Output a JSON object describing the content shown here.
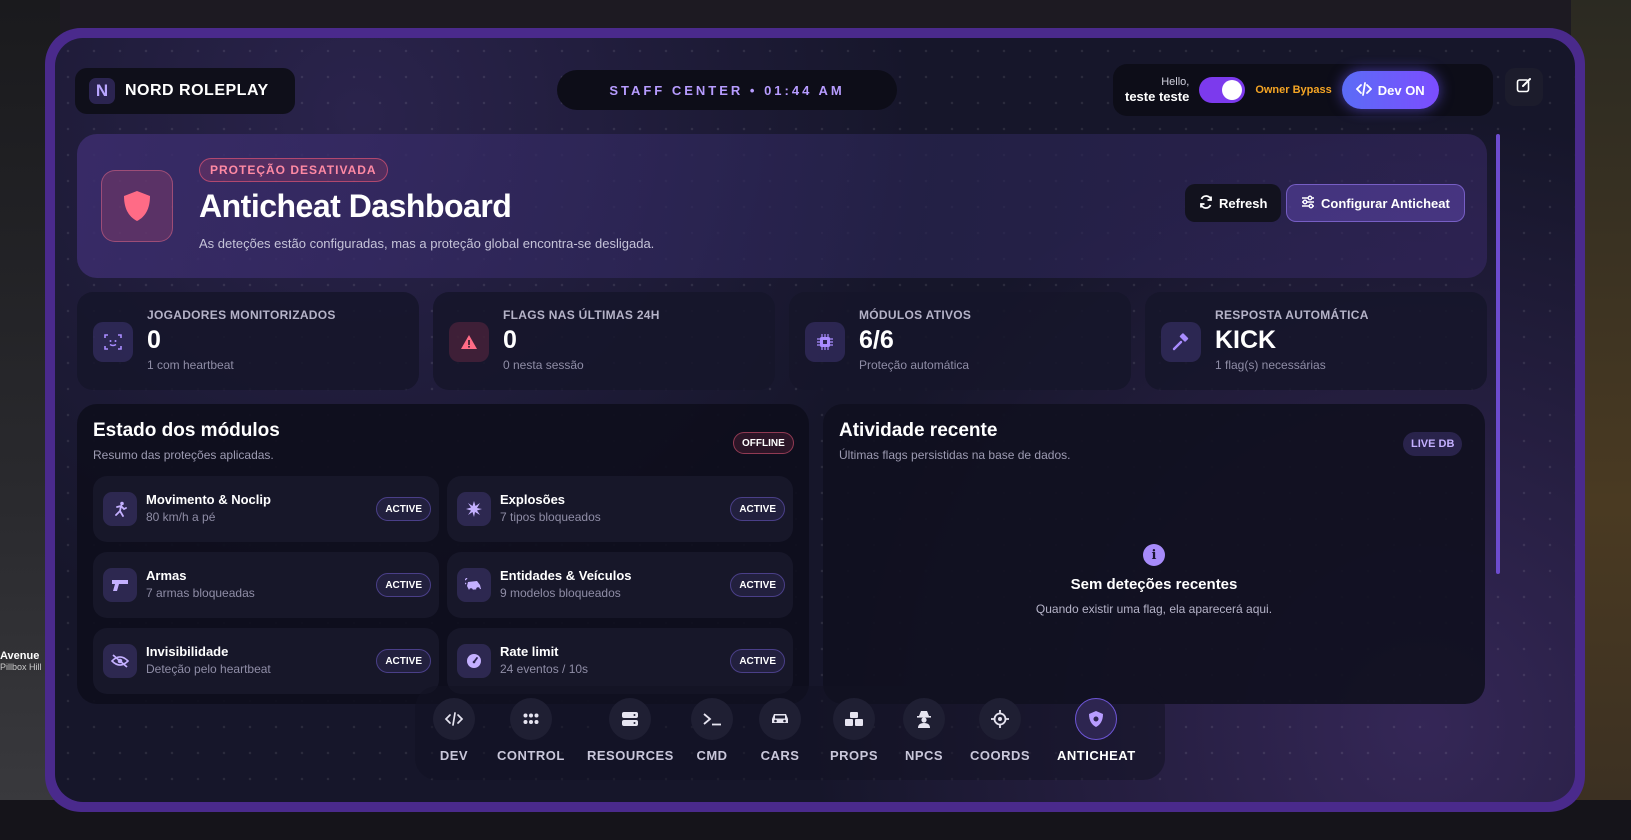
{
  "brand": {
    "logo_letter": "N",
    "name": "NORD ROLEPLAY"
  },
  "staff_center": "STAFF CENTER • 01:44 AM",
  "user": {
    "hello": "Hello,",
    "name": "teste teste",
    "bypass_label": "Owner Bypass",
    "bypass_on": true,
    "dev_label": "Dev ON"
  },
  "hero": {
    "badge": "PROTEÇÃO DESATIVADA",
    "title": "Anticheat Dashboard",
    "subtitle": "As deteções estão configuradas, mas a proteção global encontra-se desligada.",
    "refresh_label": "Refresh",
    "config_label": "Configurar Anticheat"
  },
  "stats": [
    {
      "label": "JOGADORES MONITORIZADOS",
      "value": "0",
      "sub": "1 com heartbeat",
      "icon": "scan-face-icon"
    },
    {
      "label": "FLAGS NAS ÚLTIMAS 24H",
      "value": "0",
      "sub": "0 nesta sessão",
      "icon": "warning-icon"
    },
    {
      "label": "MÓDULOS ATIVOS",
      "value": "6/6",
      "sub": "Proteção automática",
      "icon": "chip-icon"
    },
    {
      "label": "RESPOSTA AUTOMÁTICA",
      "value": "KICK",
      "sub": "1 flag(s) necessárias",
      "icon": "gavel-icon"
    }
  ],
  "modules_panel": {
    "title": "Estado dos módulos",
    "subtitle": "Resumo das proteções aplicadas.",
    "status": "OFFLINE",
    "items": [
      {
        "name": "Movimento & Noclip",
        "desc": "80 km/h a pé",
        "status": "ACTIVE",
        "icon": "running-icon"
      },
      {
        "name": "Explosões",
        "desc": "7 tipos bloqueados",
        "status": "ACTIVE",
        "icon": "explosion-icon"
      },
      {
        "name": "Armas",
        "desc": "7 armas bloqueadas",
        "status": "ACTIVE",
        "icon": "gun-icon"
      },
      {
        "name": "Entidades & Veículos",
        "desc": "9 modelos bloqueados",
        "status": "ACTIVE",
        "icon": "car-crash-icon"
      },
      {
        "name": "Invisibilidade",
        "desc": "Deteção pelo heartbeat",
        "status": "ACTIVE",
        "icon": "eye-slash-icon"
      },
      {
        "name": "Rate limit",
        "desc": "24 eventos / 10s",
        "status": "ACTIVE",
        "icon": "gauge-icon"
      }
    ]
  },
  "activity_panel": {
    "title": "Atividade recente",
    "subtitle": "Últimas flags persistidas na base de dados.",
    "badge": "LIVE DB",
    "empty_icon": "i",
    "empty_title": "Sem deteções recentes",
    "empty_sub": "Quando existir uma flag, ela aparecerá aqui."
  },
  "dock": [
    {
      "label": "DEV",
      "icon": "code-icon"
    },
    {
      "label": "CONTROL",
      "icon": "grid-dots-icon"
    },
    {
      "label": "RESOURCES",
      "icon": "server-icon"
    },
    {
      "label": "CMD",
      "icon": "terminal-icon"
    },
    {
      "label": "CARS",
      "icon": "car-icon"
    },
    {
      "label": "PROPS",
      "icon": "cubes-icon"
    },
    {
      "label": "NPCS",
      "icon": "user-secret-icon"
    },
    {
      "label": "COORDS",
      "icon": "crosshair-icon"
    },
    {
      "label": "ANTICHEAT",
      "icon": "shield-virus-icon",
      "active": true
    }
  ],
  "background": {
    "street": "Avenue",
    "district": "Pillbox Hill"
  },
  "colors": {
    "accent": "#7c3aed",
    "danger": "#ff8aa4",
    "warning": "#f5a524"
  }
}
